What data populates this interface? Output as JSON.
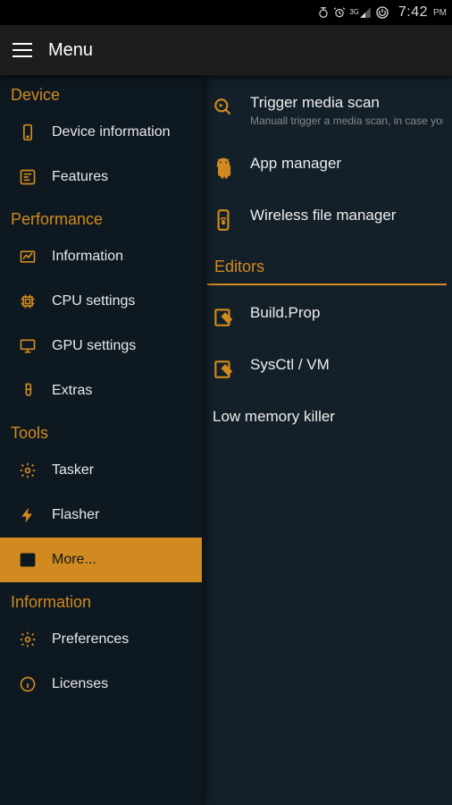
{
  "statusbar": {
    "time": "7:42",
    "ampm": "PM",
    "network_label": "3G"
  },
  "appbar": {
    "title": "Menu"
  },
  "drawer": {
    "sections": [
      {
        "label": "Device",
        "items": [
          {
            "id": "device-info",
            "label": "Device information"
          },
          {
            "id": "features",
            "label": "Features"
          }
        ]
      },
      {
        "label": "Performance",
        "items": [
          {
            "id": "perf-info",
            "label": "Information"
          },
          {
            "id": "cpu-settings",
            "label": "CPU settings"
          },
          {
            "id": "gpu-settings",
            "label": "GPU settings"
          },
          {
            "id": "extras",
            "label": "Extras"
          }
        ]
      },
      {
        "label": "Tools",
        "items": [
          {
            "id": "tasker",
            "label": "Tasker"
          },
          {
            "id": "flasher",
            "label": "Flasher"
          },
          {
            "id": "more",
            "label": "More...",
            "selected": true
          }
        ]
      },
      {
        "label": "Information",
        "items": [
          {
            "id": "preferences",
            "label": "Preferences"
          },
          {
            "id": "licenses",
            "label": "Licenses"
          }
        ]
      }
    ]
  },
  "content": {
    "top_items": [
      {
        "id": "trigger-media-scan",
        "title": "Trigger media scan",
        "sub": "Manuall trigger a media scan, in case you are connected via MTP and new files are not visible"
      },
      {
        "id": "app-manager",
        "title": "App manager"
      },
      {
        "id": "wireless-fm",
        "title": "Wireless file manager"
      }
    ],
    "editors_label": "Editors",
    "editor_items": [
      {
        "id": "build-prop",
        "title": "Build.Prop"
      },
      {
        "id": "sysctl-vm",
        "title": "SysCtl / VM"
      },
      {
        "id": "lmk",
        "title": "Low memory killer",
        "noicon": true
      }
    ]
  },
  "colors": {
    "accent": "#d18a1f",
    "bg_dark": "#0e1820",
    "bg_panel": "#142029",
    "appbar": "#1d1d1d"
  }
}
